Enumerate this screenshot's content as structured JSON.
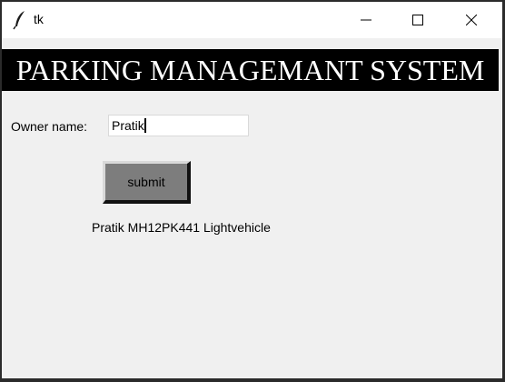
{
  "window": {
    "title": "tk",
    "icons": {
      "app": "feather-icon",
      "minimize": "minimize-icon",
      "maximize": "maximize-icon",
      "close": "close-icon"
    }
  },
  "header": {
    "banner_text": "PARKING MANAGEMANT SYSTEM",
    "banner_bg": "#000000",
    "banner_fg": "#ffffff"
  },
  "form": {
    "owner_label": "Owner name:",
    "owner_value": "Pratik",
    "submit_label": "submit",
    "submit_bg": "#7d7d7d"
  },
  "result": {
    "text": "Pratik MH12PK441 Lightvehicle"
  }
}
